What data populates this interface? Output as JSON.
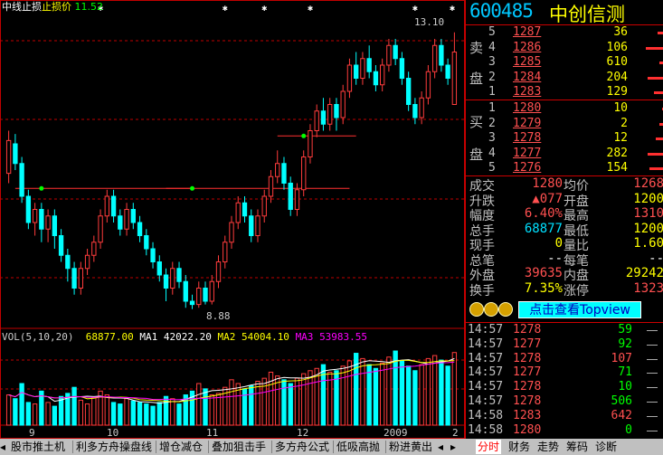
{
  "chart": {
    "indicator_label": "中线止损",
    "indicator_sub_label": "止损价",
    "indicator_value": "11.52",
    "high_label": "13.10",
    "low_label": "8.88",
    "volume_legend": {
      "title": "VOL(5,10,20)",
      "vol": "68877.00",
      "ma1_label": "MA1",
      "ma1": "42022.20",
      "ma2_label": "MA2",
      "ma2": "54004.10",
      "ma3_label": "MA3",
      "ma3": "53983.55"
    },
    "x_labels": [
      "9",
      "10",
      "11",
      "12",
      "2009",
      "2"
    ],
    "colors": {
      "up": "#ff3c3c",
      "down": "#00ffff",
      "ma1": "#ffffff",
      "ma2": "#ffff00",
      "ma3": "#ff00ff",
      "grid": "#c00000",
      "marker": "#00ff00"
    }
  },
  "quote": {
    "code": "600485",
    "name": "中创信测",
    "sell_label": [
      "卖",
      "盘"
    ],
    "buy_label": [
      "买",
      "盘"
    ],
    "sell": [
      {
        "level": "5",
        "price": "1287",
        "vol": "36",
        "bar": 0.2
      },
      {
        "level": "4",
        "price": "1286",
        "vol": "106",
        "bar": 0.55
      },
      {
        "level": "3",
        "price": "1285",
        "vol": "610",
        "bar": 0.15
      },
      {
        "level": "2",
        "price": "1284",
        "vol": "204",
        "bar": 0.5
      },
      {
        "level": "1",
        "price": "1283",
        "vol": "129",
        "bar": 0.3
      }
    ],
    "buy": [
      {
        "level": "1",
        "price": "1280",
        "vol": "10",
        "bar": 0.05
      },
      {
        "level": "2",
        "price": "1279",
        "vol": "2",
        "bar": 0.15
      },
      {
        "level": "3",
        "price": "1278",
        "vol": "12",
        "bar": 0.25
      },
      {
        "level": "4",
        "price": "1277",
        "vol": "282",
        "bar": 0.5
      },
      {
        "level": "5",
        "price": "1276",
        "vol": "154",
        "bar": 0.45
      }
    ],
    "stats": [
      {
        "l1": "成交",
        "v1": "1280",
        "c1": "red",
        "l2": "均价",
        "v2": "1268",
        "c2": "red"
      },
      {
        "l1": "升跌",
        "v1": "▲077",
        "c1": "red",
        "l2": "开盘",
        "v2": "1200",
        "c2": "yel"
      },
      {
        "l1": "幅度",
        "v1": "6.40%",
        "c1": "red",
        "l2": "最高",
        "v2": "1310",
        "c2": "red"
      },
      {
        "l1": "总手",
        "v1": "68877",
        "c1": "cyan",
        "l2": "最低",
        "v2": "1200",
        "c2": "yel"
      },
      {
        "l1": "现手",
        "v1": "0",
        "c1": "yel",
        "l2": "量比",
        "v2": "1.60",
        "c2": "yel"
      },
      {
        "l1": "总笔",
        "v1": "--",
        "c1": "wht",
        "l2": "每笔",
        "v2": "--",
        "c2": "wht"
      },
      {
        "l1": "外盘",
        "v1": "39635",
        "c1": "red",
        "l2": "内盘",
        "v2": "29242",
        "c2": "yel"
      },
      {
        "l1": "换手",
        "v1": "7.35%",
        "c1": "yel",
        "l2": "涨停",
        "v2": "1323",
        "c2": "red"
      }
    ],
    "topview_label": "点击查看Topview",
    "ticks": [
      {
        "time": "14:57",
        "price": "1278",
        "vol": "59",
        "vc": "grn"
      },
      {
        "time": "14:57",
        "price": "1277",
        "vol": "92",
        "vc": "grn"
      },
      {
        "time": "14:57",
        "price": "1278",
        "vol": "107",
        "vc": "red"
      },
      {
        "time": "14:57",
        "price": "1277",
        "vol": "71",
        "vc": "grn"
      },
      {
        "time": "14:57",
        "price": "1278",
        "vol": "10",
        "vc": "grn"
      },
      {
        "time": "14:57",
        "price": "1278",
        "vol": "506",
        "vc": "grn"
      },
      {
        "time": "14:58",
        "price": "1283",
        "vol": "642",
        "vc": "red"
      },
      {
        "time": "14:58",
        "price": "1280",
        "vol": "0",
        "vc": "grn"
      }
    ]
  },
  "bottom_tabs": [
    "股市推土机",
    "利多方舟操盘线",
    "增仓减仓",
    "叠加狙击手",
    "多方舟公式",
    "低吸高抛",
    "粉进黄出"
  ],
  "right_tabs": [
    "分时",
    "财务",
    "走势",
    "筹码",
    "诊断"
  ],
  "chart_data": {
    "type": "candlestick",
    "ylim": [
      8.6,
      13.4
    ],
    "candles": [
      [
        10.95,
        11.45,
        10.8,
        11.6
      ],
      [
        11.4,
        11.1,
        11.0,
        11.55
      ],
      [
        11.1,
        10.6,
        10.5,
        11.2
      ],
      [
        10.6,
        10.2,
        10.1,
        10.7
      ],
      [
        10.2,
        10.4,
        10.0,
        10.5
      ],
      [
        10.4,
        10.1,
        9.9,
        10.5
      ],
      [
        10.1,
        10.3,
        9.9,
        10.4
      ],
      [
        10.3,
        10.0,
        9.8,
        10.4
      ],
      [
        10.0,
        9.7,
        9.6,
        10.1
      ],
      [
        9.7,
        9.5,
        9.3,
        9.8
      ],
      [
        9.5,
        9.2,
        9.1,
        9.6
      ],
      [
        9.2,
        9.5,
        9.1,
        9.6
      ],
      [
        9.5,
        9.7,
        9.4,
        9.8
      ],
      [
        9.7,
        9.9,
        9.6,
        10.0
      ],
      [
        9.9,
        10.3,
        9.8,
        10.4
      ],
      [
        10.3,
        10.6,
        10.2,
        10.7
      ],
      [
        10.6,
        10.3,
        10.2,
        10.7
      ],
      [
        10.3,
        10.1,
        10.0,
        10.4
      ],
      [
        10.1,
        10.4,
        10.0,
        10.5
      ],
      [
        10.4,
        10.2,
        10.1,
        10.5
      ],
      [
        10.2,
        10.0,
        9.9,
        10.3
      ],
      [
        10.0,
        9.8,
        9.7,
        10.1
      ],
      [
        9.8,
        9.6,
        9.5,
        9.9
      ],
      [
        9.6,
        9.4,
        9.3,
        9.7
      ],
      [
        9.4,
        9.2,
        9.0,
        9.5
      ],
      [
        9.2,
        9.5,
        9.1,
        9.6
      ],
      [
        9.5,
        9.3,
        9.2,
        9.6
      ],
      [
        9.3,
        9.0,
        8.9,
        9.4
      ],
      [
        9.0,
        8.95,
        8.88,
        9.1
      ],
      [
        8.95,
        9.2,
        8.9,
        9.3
      ],
      [
        9.2,
        9.0,
        8.95,
        9.3
      ],
      [
        9.0,
        9.3,
        8.95,
        9.4
      ],
      [
        9.3,
        9.6,
        9.2,
        9.7
      ],
      [
        9.6,
        9.9,
        9.5,
        10.0
      ],
      [
        9.9,
        10.2,
        9.8,
        10.3
      ],
      [
        10.2,
        10.5,
        10.1,
        10.6
      ],
      [
        10.5,
        10.3,
        10.2,
        10.6
      ],
      [
        10.3,
        10.0,
        9.9,
        10.4
      ],
      [
        10.0,
        10.3,
        9.9,
        10.4
      ],
      [
        10.3,
        10.6,
        10.2,
        10.7
      ],
      [
        10.6,
        10.9,
        10.5,
        11.0
      ],
      [
        10.9,
        11.1,
        10.8,
        11.3
      ],
      [
        11.1,
        10.8,
        10.7,
        11.2
      ],
      [
        10.8,
        10.4,
        10.3,
        10.9
      ],
      [
        10.4,
        10.7,
        10.3,
        10.8
      ],
      [
        10.7,
        11.2,
        10.6,
        11.3
      ],
      [
        11.2,
        11.6,
        11.1,
        11.7
      ],
      [
        11.6,
        11.9,
        11.5,
        12.0
      ],
      [
        11.9,
        11.7,
        11.6,
        12.1
      ],
      [
        11.7,
        12.0,
        11.6,
        12.1
      ],
      [
        12.0,
        11.8,
        11.6,
        12.1
      ],
      [
        11.8,
        12.2,
        11.7,
        12.3
      ],
      [
        12.2,
        12.6,
        12.1,
        12.7
      ],
      [
        12.6,
        12.4,
        12.3,
        12.8
      ],
      [
        12.4,
        12.7,
        12.3,
        12.8
      ],
      [
        12.7,
        12.5,
        12.4,
        12.9
      ],
      [
        12.5,
        12.3,
        12.2,
        12.6
      ],
      [
        12.3,
        12.6,
        12.2,
        12.7
      ],
      [
        12.6,
        12.9,
        12.5,
        13.0
      ],
      [
        12.9,
        12.7,
        12.6,
        13.0
      ],
      [
        12.7,
        12.4,
        12.3,
        12.8
      ],
      [
        12.4,
        12.0,
        11.9,
        12.5
      ],
      [
        12.0,
        11.8,
        11.7,
        12.1
      ],
      [
        11.8,
        12.1,
        11.7,
        12.2
      ],
      [
        12.1,
        12.5,
        12.0,
        12.6
      ],
      [
        12.5,
        12.9,
        12.4,
        13.0
      ],
      [
        12.9,
        12.6,
        12.5,
        13.0
      ],
      [
        12.6,
        12.4,
        12.3,
        12.7
      ],
      [
        12.0,
        12.8,
        12.0,
        13.1
      ]
    ],
    "stop_lines": [
      {
        "from": 1,
        "to": 28,
        "value": 10.72
      },
      {
        "from": 24,
        "to": 52,
        "value": 10.72
      },
      {
        "from": 41,
        "to": 53,
        "value": 11.52
      }
    ],
    "volume": [
      40,
      35,
      55,
      30,
      28,
      45,
      30,
      25,
      38,
      42,
      50,
      33,
      28,
      36,
      45,
      40,
      30,
      28,
      35,
      32,
      30,
      28,
      25,
      30,
      38,
      35,
      28,
      40,
      45,
      55,
      48,
      40,
      42,
      50,
      60,
      55,
      48,
      52,
      58,
      62,
      70,
      65,
      60,
      55,
      62,
      68,
      72,
      75,
      80,
      70,
      72,
      78,
      85,
      95,
      88,
      80,
      75,
      82,
      90,
      98,
      85,
      78,
      72,
      80,
      88,
      92,
      86,
      78,
      96
    ],
    "volume_ylim": [
      0,
      110
    ]
  }
}
